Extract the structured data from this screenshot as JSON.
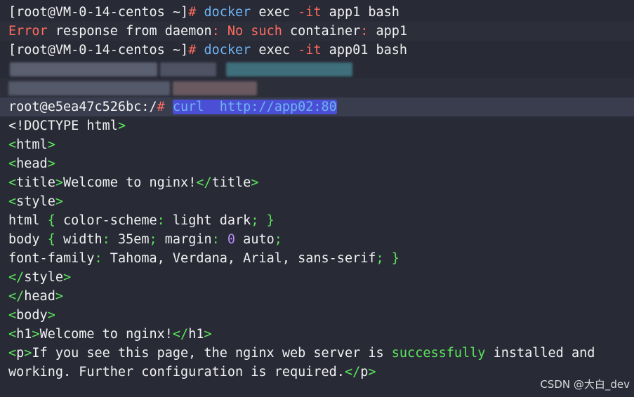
{
  "terminal": {
    "lines": [
      {
        "segments": [
          {
            "t": "[root@VM-0-14-centos ~]",
            "c": "w"
          },
          {
            "t": "# ",
            "c": "o"
          },
          {
            "t": "docker",
            "c": "c"
          },
          {
            "t": " exec ",
            "c": "w"
          },
          {
            "t": "-it",
            "c": "o"
          },
          {
            "t": " app1 bash",
            "c": "w"
          }
        ]
      },
      {
        "segments": [
          {
            "t": "Error",
            "c": "o"
          },
          {
            "t": " response from daemon",
            "c": "w"
          },
          {
            "t": ":",
            "c": "o"
          },
          {
            "t": " ",
            "c": "w"
          },
          {
            "t": "No such",
            "c": "o"
          },
          {
            "t": " container",
            "c": "w"
          },
          {
            "t": ":",
            "c": "o"
          },
          {
            "t": " app1",
            "c": "w"
          }
        ]
      },
      {
        "segments": [
          {
            "t": "[root@VM-0-14-centos ~]",
            "c": "w"
          },
          {
            "t": "# ",
            "c": "o"
          },
          {
            "t": "docker",
            "c": "c"
          },
          {
            "t": " exec ",
            "c": "w"
          },
          {
            "t": "-it",
            "c": "o"
          },
          {
            "t": " app01 bash",
            "c": "w"
          }
        ]
      },
      {
        "segments": []
      },
      {
        "segments": []
      },
      {
        "segments": [
          {
            "t": "root@e5ea47c526bc:/",
            "c": "w"
          },
          {
            "t": "# ",
            "c": "o"
          },
          {
            "t": "curl  http://app02:80",
            "c": "sel"
          }
        ]
      },
      {
        "segments": [
          {
            "t": "<!DOCTYPE html",
            "c": "w"
          },
          {
            "t": ">",
            "c": "g"
          }
        ]
      },
      {
        "segments": [
          {
            "t": "<",
            "c": "g"
          },
          {
            "t": "html",
            "c": "w"
          },
          {
            "t": ">",
            "c": "g"
          }
        ]
      },
      {
        "segments": [
          {
            "t": "<",
            "c": "g"
          },
          {
            "t": "head",
            "c": "w"
          },
          {
            "t": ">",
            "c": "g"
          }
        ]
      },
      {
        "segments": [
          {
            "t": "<",
            "c": "g"
          },
          {
            "t": "title",
            "c": "w"
          },
          {
            "t": ">",
            "c": "g"
          },
          {
            "t": "Welcome to nginx!",
            "c": "w"
          },
          {
            "t": "</",
            "c": "g"
          },
          {
            "t": "title",
            "c": "w"
          },
          {
            "t": ">",
            "c": "g"
          }
        ]
      },
      {
        "segments": [
          {
            "t": "<",
            "c": "g"
          },
          {
            "t": "style",
            "c": "w"
          },
          {
            "t": ">",
            "c": "g"
          }
        ]
      },
      {
        "segments": [
          {
            "t": "html ",
            "c": "w"
          },
          {
            "t": "{",
            "c": "g"
          },
          {
            "t": " color-scheme",
            "c": "w"
          },
          {
            "t": ":",
            "c": "g"
          },
          {
            "t": " light dark",
            "c": "w"
          },
          {
            "t": ";",
            "c": "g"
          },
          {
            "t": " ",
            "c": "w"
          },
          {
            "t": "}",
            "c": "g"
          }
        ]
      },
      {
        "segments": [
          {
            "t": "body ",
            "c": "w"
          },
          {
            "t": "{",
            "c": "g"
          },
          {
            "t": " width",
            "c": "w"
          },
          {
            "t": ":",
            "c": "g"
          },
          {
            "t": " 35em",
            "c": "w"
          },
          {
            "t": ";",
            "c": "g"
          },
          {
            "t": " margin",
            "c": "w"
          },
          {
            "t": ":",
            "c": "g"
          },
          {
            "t": " ",
            "c": "w"
          },
          {
            "t": "0",
            "c": "v"
          },
          {
            "t": " auto",
            "c": "w"
          },
          {
            "t": ";",
            "c": "g"
          }
        ]
      },
      {
        "segments": [
          {
            "t": "font-family",
            "c": "w"
          },
          {
            "t": ":",
            "c": "g"
          },
          {
            "t": " Tahoma, Verdana, Arial, sans-serif",
            "c": "w"
          },
          {
            "t": ";",
            "c": "g"
          },
          {
            "t": " ",
            "c": "w"
          },
          {
            "t": "}",
            "c": "g"
          }
        ]
      },
      {
        "segments": [
          {
            "t": "</",
            "c": "g"
          },
          {
            "t": "style",
            "c": "w"
          },
          {
            "t": ">",
            "c": "g"
          }
        ]
      },
      {
        "segments": [
          {
            "t": "</",
            "c": "g"
          },
          {
            "t": "head",
            "c": "w"
          },
          {
            "t": ">",
            "c": "g"
          }
        ]
      },
      {
        "segments": [
          {
            "t": "<",
            "c": "g"
          },
          {
            "t": "body",
            "c": "w"
          },
          {
            "t": ">",
            "c": "g"
          }
        ]
      },
      {
        "segments": [
          {
            "t": "<",
            "c": "g"
          },
          {
            "t": "h1",
            "c": "w"
          },
          {
            "t": ">",
            "c": "g"
          },
          {
            "t": "Welcome to nginx!",
            "c": "w"
          },
          {
            "t": "</",
            "c": "g"
          },
          {
            "t": "h1",
            "c": "w"
          },
          {
            "t": ">",
            "c": "g"
          }
        ]
      },
      {
        "segments": [
          {
            "t": "<",
            "c": "g"
          },
          {
            "t": "p",
            "c": "w"
          },
          {
            "t": ">",
            "c": "g"
          },
          {
            "t": "If you see this page, the nginx web server is ",
            "c": "w"
          },
          {
            "t": "successfully",
            "c": "g"
          },
          {
            "t": " installed and",
            "c": "w"
          }
        ]
      },
      {
        "segments": [
          {
            "t": "working. Further configuration is required.",
            "c": "w"
          },
          {
            "t": "</",
            "c": "g"
          },
          {
            "t": "p",
            "c": "w"
          },
          {
            "t": ">",
            "c": "g"
          }
        ]
      }
    ]
  },
  "watermark": "CSDN @大白_dev",
  "colors": {
    "background": "#282a36",
    "text": "#f1f1f1",
    "command": "#6fb3f2",
    "accent_red": "#ff6b5e",
    "accent_green": "#5ce65c",
    "selection": "#4a4fd6"
  }
}
